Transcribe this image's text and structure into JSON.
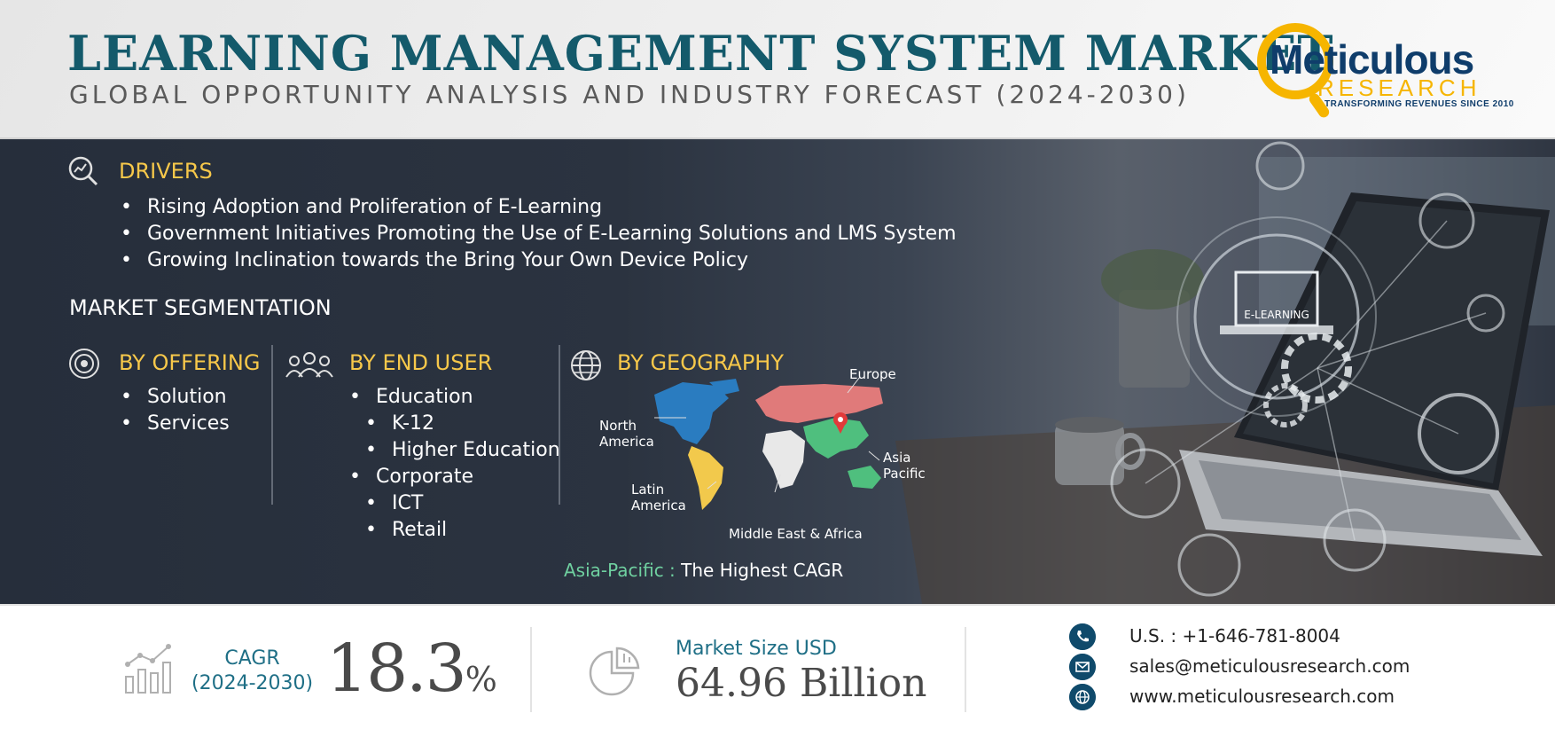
{
  "header": {
    "title": "LEARNING MANAGEMENT SYSTEM MARKET",
    "subtitle": "GLOBAL OPPORTUNITY ANALYSIS AND INDUSTRY FORECAST (2024-2030)"
  },
  "logo": {
    "name": "Meticulous",
    "research": "RESEARCH",
    "tagline": "TRANSFORMING REVENUES SINCE 2010"
  },
  "drivers": {
    "heading": "DRIVERS",
    "items": [
      "Rising Adoption and Proliferation of E-Learning",
      "Government Initiatives Promoting the Use of E-Learning Solutions and LMS System",
      "Growing Inclination towards the Bring Your Own Device Policy"
    ]
  },
  "segmentation": {
    "title": "MARKET SEGMENTATION",
    "offering": {
      "heading": "BY OFFERING",
      "items": [
        "Solution",
        "Services"
      ]
    },
    "end_user": {
      "heading": "BY END USER",
      "items": [
        "Education",
        "K-12",
        "Higher Education",
        "Corporate",
        "ICT",
        "Retail"
      ]
    },
    "geography": {
      "heading": "BY GEOGRAPHY",
      "regions": {
        "europe": "Europe",
        "north_america": "North America",
        "asia_pacific": "Asia Pacific",
        "latin_america": "Latin America",
        "mea": "Middle East & Africa"
      },
      "highest_region": "Asia-Pacific :",
      "highest_text": "The Highest CAGR"
    }
  },
  "screen_label": "E-LEARNING",
  "footer": {
    "cagr_label_1": "CAGR",
    "cagr_label_2": "(2024-2030)",
    "cagr_value": "18.3",
    "cagr_unit": "%",
    "market_size_label": "Market Size USD",
    "market_size_value": "64.96 Billion",
    "phone": "U.S. : +1-646-781-8004",
    "email": "sales@meticulousresearch.com",
    "website": "www.meticulousresearch.com"
  },
  "colors": {
    "title": "#145a6b",
    "accent_yellow": "#f7c84a",
    "footer_label": "#1f6f86",
    "band": "#2b3340",
    "map_north_america": "#2a7cc0",
    "map_europe": "#e07a7a",
    "map_asia": "#4fbf7e",
    "map_latin_america": "#f2c94c",
    "map_africa": "#e8e8e8",
    "map_oceania": "#4fbf7e"
  }
}
